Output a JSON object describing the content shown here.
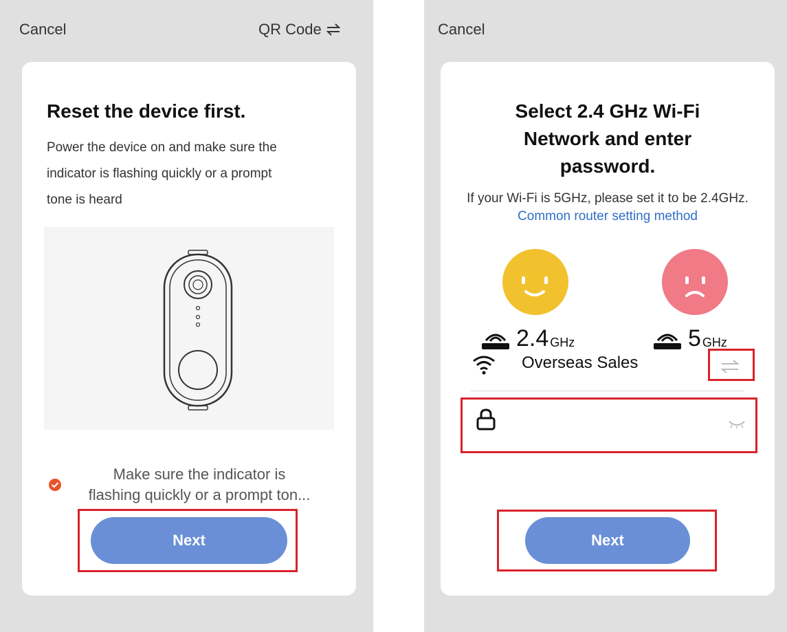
{
  "left_screen": {
    "cancel_label": "Cancel",
    "qr_label": "QR Code",
    "qr_icon": "swap-arrows-icon",
    "title": "Reset the device first.",
    "instruction_lines": [
      "Power the device on and make sure the",
      "indicator is flashing quickly or a prompt",
      "tone is heard"
    ],
    "illustration": "doorbell-device",
    "confirm_lines": [
      "Make sure the indicator is",
      "flashing quickly or a prompt ton..."
    ],
    "confirm_checked": true,
    "next_label": "Next"
  },
  "right_screen": {
    "cancel_label": "Cancel",
    "title_lines": [
      "Select 2.4 GHz Wi-Fi",
      "Network and enter",
      "password."
    ],
    "info_text": "If your Wi-Fi is 5GHz, please set it to be 2.4GHz.",
    "link_text": "Common router setting method",
    "good_band_value": "2.4",
    "good_band_unit": "GHz",
    "bad_band_value": "5",
    "bad_band_unit": "GHz",
    "network_name": "Overseas Sales",
    "password_value": "",
    "next_label": "Next"
  },
  "colors": {
    "accent_button": "#6a8fd6",
    "link": "#2e6ec9",
    "highlight_box": "#d9222a",
    "check": "#e8552a",
    "happy_face": "#f2c12e",
    "sad_face": "#f07a86"
  }
}
